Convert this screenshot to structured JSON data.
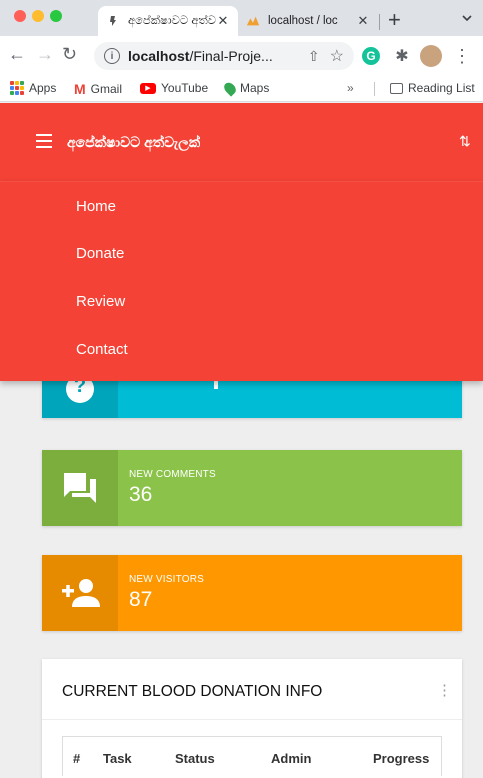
{
  "browser": {
    "tabs": [
      {
        "title": "අපේක්ෂාවට අත්වැ",
        "active": true
      },
      {
        "title": "localhost / loc",
        "active": false
      }
    ],
    "address": {
      "host": "localhost",
      "path": "/Final-Proje..."
    },
    "bookmarks": [
      {
        "label": "Apps",
        "icon": "apps-grid-icon"
      },
      {
        "label": "Gmail",
        "icon": "gmail-icon"
      },
      {
        "label": "YouTube",
        "icon": "youtube-icon"
      },
      {
        "label": "Maps",
        "icon": "maps-icon"
      }
    ],
    "bookmarks_more": "»",
    "reading_list": "Reading List"
  },
  "appbar": {
    "brand": "අපේක්ෂාවට අත්වැලක්",
    "color": "#f44336"
  },
  "drawer": {
    "items": [
      "Home",
      "Donate",
      "Review",
      "Contact"
    ]
  },
  "cards": [
    {
      "label": "",
      "value": "",
      "color": "#00bcd4",
      "icon": "help-icon"
    },
    {
      "label": "NEW COMMENTS",
      "value": "36",
      "color": "#8bc34a",
      "icon": "forum-icon"
    },
    {
      "label": "NEW VISITORS",
      "value": "87",
      "color": "#ff9800",
      "icon": "person-add-icon"
    }
  ],
  "panel": {
    "title": "CURRENT BLOOD DONATION INFO",
    "columns": [
      "#",
      "Task",
      "Status",
      "Admin",
      "Progress"
    ]
  }
}
